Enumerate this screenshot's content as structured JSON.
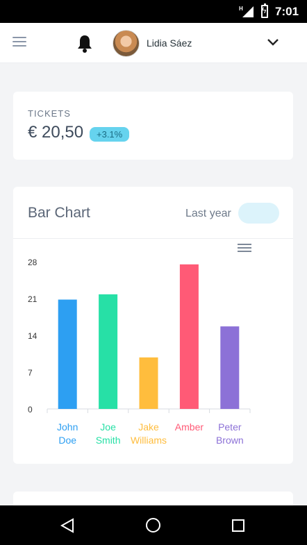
{
  "status_bar": {
    "network": "H",
    "time": "7:01"
  },
  "header": {
    "menu_icon": "hamburger-icon",
    "notification_icon": "bell-icon",
    "user_name": "Lidia Sáez",
    "dropdown_icon": "chevron-down-icon"
  },
  "tickets": {
    "label": "TICKETS",
    "value": "€ 20,50",
    "change": "+3.1%"
  },
  "chart_card": {
    "title": "Bar Chart",
    "period_label": "Last year",
    "menu_icon": "menu-icon"
  },
  "chart_data": {
    "type": "bar",
    "categories": [
      "John Doe",
      "Joe Smith",
      "Jake Williams",
      "Amber",
      "Peter Brown"
    ],
    "category_lines": [
      [
        "John",
        "Doe"
      ],
      [
        "Joe",
        "Smith"
      ],
      [
        "Jake",
        "Williams"
      ],
      [
        "Amber"
      ],
      [
        "Peter",
        "Brown"
      ]
    ],
    "values": [
      20.8,
      21.8,
      9.8,
      27.5,
      15.7
    ],
    "colors": [
      "#2d9ff2",
      "#27e0a6",
      "#ffbd3d",
      "#ff5a76",
      "#8c71d7"
    ],
    "ylim": [
      0,
      28
    ],
    "yticks": [
      0,
      7,
      14,
      21,
      28
    ],
    "grid": false,
    "title": "",
    "xlabel": "",
    "ylabel": ""
  },
  "nav_bar": {
    "back_icon": "back-icon",
    "home_icon": "home-icon",
    "recents_icon": "recents-icon"
  }
}
